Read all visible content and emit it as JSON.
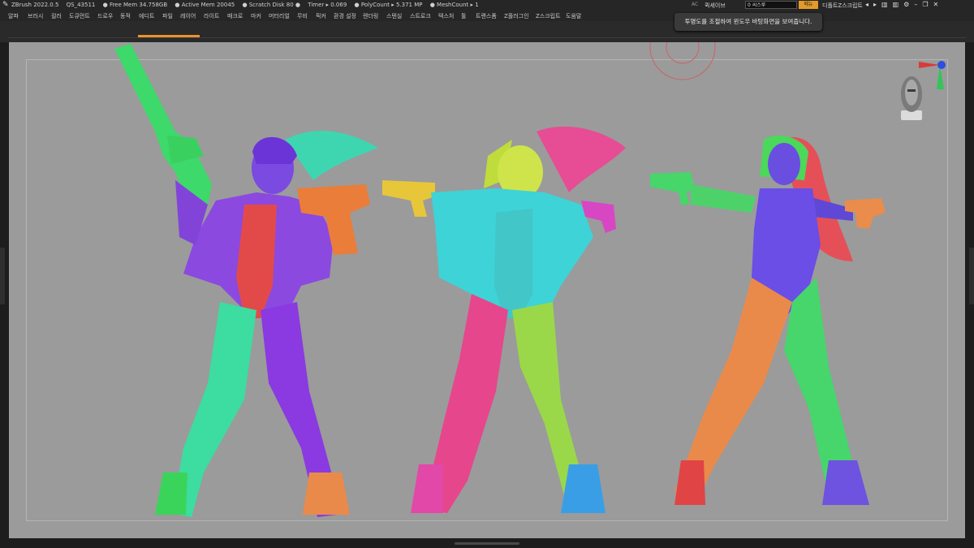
{
  "titlebar": {
    "app": "ZBrush 2022.0.5",
    "file": "QS_43511",
    "free_mem": "● Free Mem 34.758GB",
    "active_mem": "● Active Mem 20045",
    "scratch": "● Scratch Disk 80 ●",
    "timer": "Timer ▸ 0.069",
    "polycount": "● PolyCount ▸ 5.371 MP",
    "meshcount": "● MeshCount ▸ 1",
    "ac_label": "AC",
    "quicksave": "퀵세이브",
    "see_through": "0 씨스루",
    "menu_button": "메뉴",
    "default_zscript": "디폴트Z스크립트"
  },
  "menu": [
    "알파",
    "브러시",
    "컬러",
    "도큐먼트",
    "드로우",
    "동적",
    "에디트",
    "파일",
    "레이어",
    "라이트",
    "매크로",
    "마커",
    "머터리얼",
    "무비",
    "픽커",
    "환경 설정",
    "렌더링",
    "스텐실",
    "스트로크",
    "텍스처",
    "툴",
    "트랜스폼",
    "Z플러그인",
    "Z스크립트",
    "도움말"
  ],
  "tooltip": "투명도를 조절하여 윈도우 바탕화면을 보여줍니다.",
  "colors": {
    "accent": "#e7942b",
    "canvas_bg": "#9b9b9b",
    "ui_dark": "#262626"
  },
  "icons": [
    "zbrush-logo-icon",
    "minimize-icon",
    "restore-icon",
    "close-icon",
    "gyro-axis-icon",
    "head-bust-icon"
  ]
}
